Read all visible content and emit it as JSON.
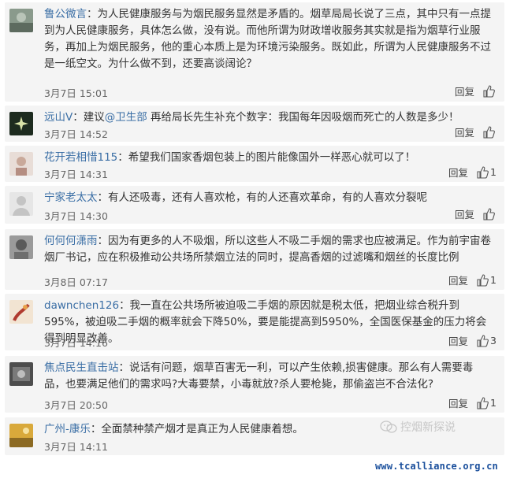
{
  "comments": [
    {
      "user": "鲁公微言",
      "text": "：为人民健康服务与为烟民服务显然是矛盾的。烟草局局长说了三点，其中只有一点提到为人民健康服务，具体怎么做，没有说。而他所谓为财政增收服务其实就是指为烟草行业服务，再加上为烟民服务，他的重心本质上是为环境污染服务。既如此，所谓为人民健康服务不过是一纸空文。为什么做不到，还要高谈阔论？",
      "time": "3月7日 15:01",
      "reply": "回复",
      "likes": ""
    },
    {
      "user": "远山V",
      "text_before": "：建议",
      "mention": "@卫生部",
      "text": " 再给局长先生补充个数字：我国每年因吸烟而死亡的人数是多少！",
      "time": "3月7日 14:52",
      "reply": "回复",
      "likes": ""
    },
    {
      "user": "花开若相惜115",
      "text": "：希望我们国家香烟包装上的图片能像国外一样恶心就可以了！",
      "time": "3月7日 14:31",
      "reply": "回复",
      "likes": "1"
    },
    {
      "user": "宁家老太太",
      "text": "：有人还吸毒，还有人喜欢枪，有的人还喜欢革命，有的人喜欢分裂呢",
      "time": "3月7日 14:30",
      "reply": "回复",
      "likes": ""
    },
    {
      "user": "何何何潇雨",
      "text": "：因为有更多的人不吸烟，所以这些人不吸二手烟的需求也应被满足。作为前宇宙卷烟厂书记，应在积极推动公共场所禁烟立法的同时，提高香烟的过滤嘴和烟丝的长度比例",
      "time": "3月8日 07:17",
      "reply": "回复",
      "likes": "1"
    },
    {
      "user": "dawnchen126",
      "text": "：我一直在公共场所被迫吸二手烟的原因就是税太低，把烟业综合税升到595%，被迫吸二手烟的概率就会下降50%，要是能提高到5950%，全国医保基金的压力将会得到明显改善。",
      "time": "3月7日 14:16",
      "reply": "回复",
      "likes": "3"
    },
    {
      "user": "焦点民生直击站",
      "text": "：说话有问题，烟草百害无一利，可以产生依赖,损害健康。那么有人需要毒品，也要满足他们的需求吗?大毒要禁，小毒就放?杀人要枪毙，那偷盗岂不合法化?",
      "time": "3月7日 20:50",
      "reply": "回复",
      "likes": "1"
    },
    {
      "user": "广州-康乐",
      "text": "：全面禁种禁产烟才是真正为人民健康着想。",
      "time": "3月7日 14:11",
      "reply": "",
      "likes": ""
    }
  ],
  "watermark": "控烟新探说",
  "site_url": "www.tcalliance.org.cn"
}
